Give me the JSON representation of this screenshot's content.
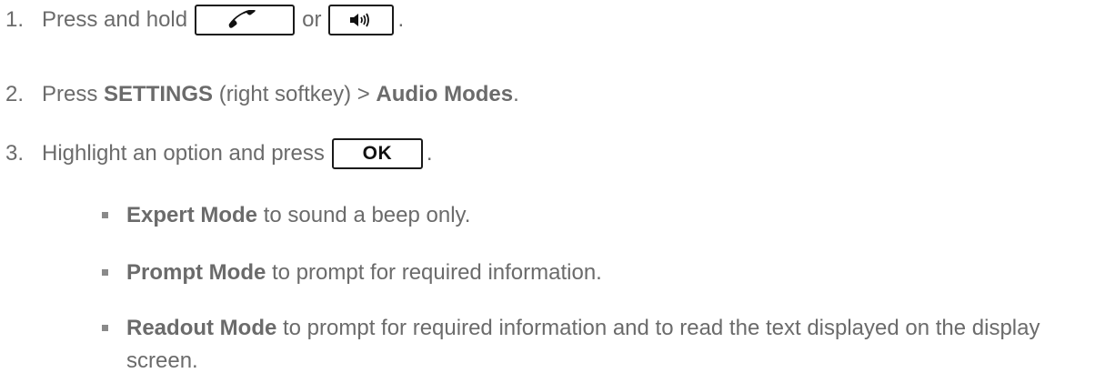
{
  "step1": {
    "number": "1.",
    "text_before": "Press and hold",
    "connector": "or",
    "end_punct": ".",
    "talk_key_icon": "phone-handset-icon",
    "speaker_key_icon": "speaker-icon"
  },
  "step2": {
    "number": "2.",
    "text_before": "Press ",
    "settings": "SETTINGS",
    "middle": " (right softkey) > ",
    "audio_modes": "Audio Modes",
    "end_punct": "."
  },
  "step3": {
    "number": "3.",
    "text_before": "Highlight an option and press",
    "ok_key_label": "OK",
    "end_punct": "."
  },
  "options": [
    {
      "name": "Expert Mode",
      "desc": " to sound a beep only."
    },
    {
      "name": "Prompt Mode",
      "desc": " to prompt for required information."
    },
    {
      "name": "Readout Mode",
      "desc": " to prompt for required information and to read the text displayed on the display screen."
    }
  ]
}
